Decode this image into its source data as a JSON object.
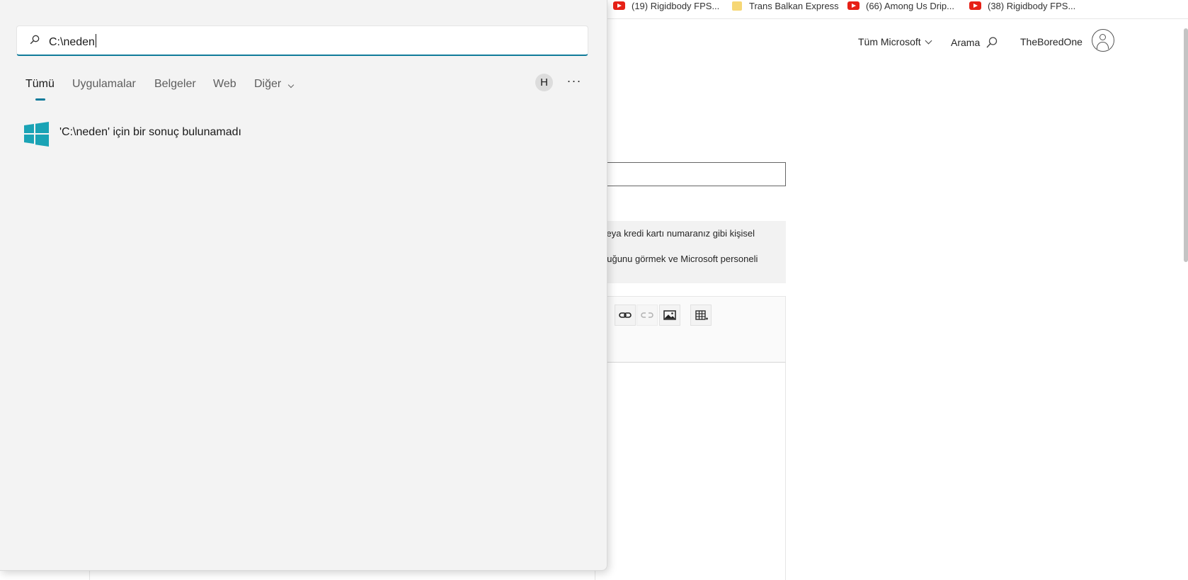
{
  "bookmarks": [
    {
      "label": "(19) Rigidbody FPS...",
      "icon": "youtube-icon"
    },
    {
      "label": "Trans Balkan Express",
      "icon": "folder-icon"
    },
    {
      "label": "(66) Among Us Drip...",
      "icon": "youtube-icon"
    },
    {
      "label": "(38) Rigidbody FPS...",
      "icon": "youtube-icon"
    }
  ],
  "ms_header": {
    "all_microsoft": "Tüm Microsoft",
    "search": "Arama",
    "username": "TheBoredOne"
  },
  "page": {
    "notice_line1": "veya kredi kartı numaranız gibi kişisel",
    "notice_line2": "duğunu görmek ve Microsoft personeli"
  },
  "editor_toolbar": [
    "link-icon",
    "unlink-icon",
    "image-icon",
    "table-icon"
  ],
  "search": {
    "query": "C:\\neden",
    "tabs": [
      "Tümü",
      "Uygulamalar",
      "Belgeler",
      "Web",
      "Diğer"
    ],
    "active_tab": "Tümü",
    "user_initial": "H",
    "more": "···",
    "result": "'C:\\neden' için bir sonuç bulunamadı"
  },
  "colors": {
    "accent": "#0f7b9a",
    "windows_logo": "#1aa3b5",
    "youtube_red": "#e62117",
    "panel_bg": "#f3f3f3"
  }
}
